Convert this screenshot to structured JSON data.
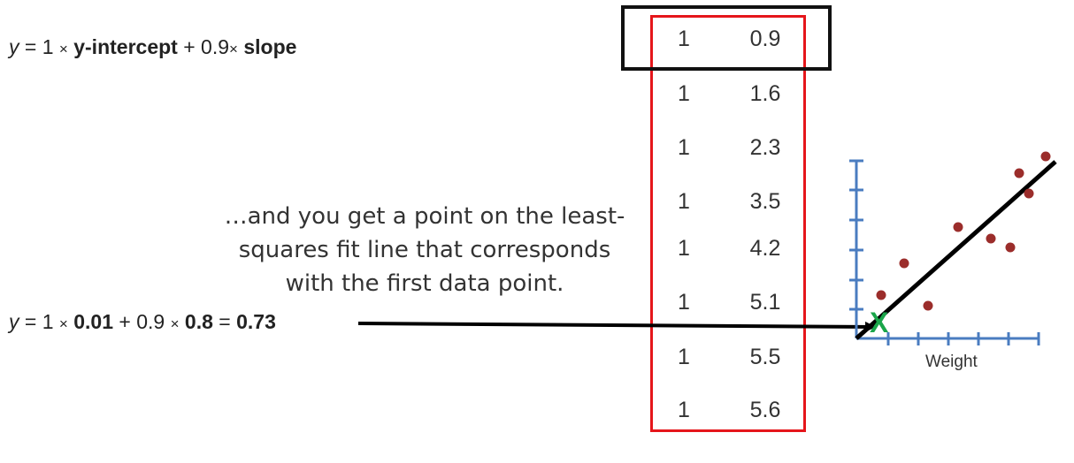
{
  "equation1": {
    "y": "y",
    "eq": "= 1",
    "times1": "×",
    "term1": "y-intercept",
    "plus": "+ 0.9",
    "times2": "×",
    "term2": "slope"
  },
  "equation2": {
    "y": "y",
    "eq": "= 1",
    "times1": "×",
    "term1": "0.01",
    "plus": "+ 0.9",
    "times2": "×",
    "term2": "0.8",
    "equals": "=",
    "result": "0.73"
  },
  "caption": "…and you get a point on the least-squares fit line that corresponds with the first data point.",
  "caption_lines": [
    "…and you get a point on the least-",
    "squares fit line that corresponds",
    "with the first data point."
  ],
  "matrix": {
    "col1": [
      "1",
      "1",
      "1",
      "1",
      "1",
      "1",
      "1",
      "1"
    ],
    "col2": [
      "0.9",
      "1.6",
      "2.3",
      "3.5",
      "4.2",
      "5.1",
      "5.5",
      "5.6"
    ],
    "highlighted_row": 0
  },
  "plot": {
    "xlabel": "Weight",
    "marker": "X",
    "colors": {
      "axis": "#4a7cc0",
      "points": "#9b2d2b",
      "fit_line": "#000000",
      "marker": "#1aa54a",
      "red_box": "#e5161b"
    }
  }
}
